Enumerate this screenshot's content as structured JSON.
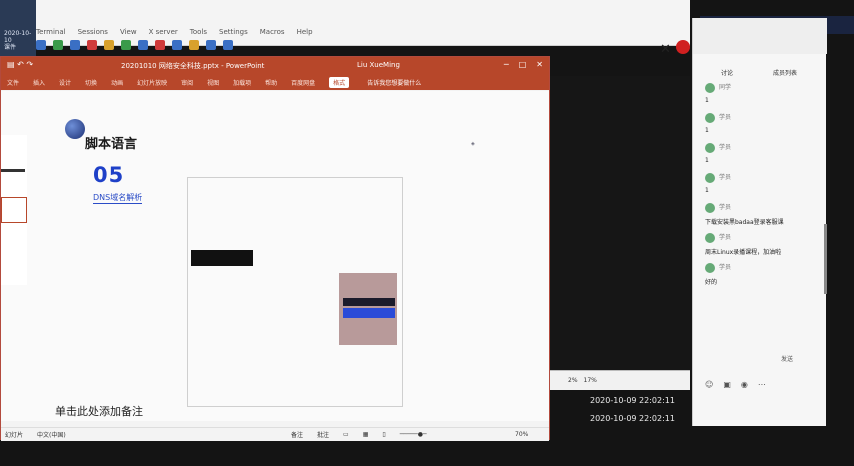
{
  "top_app": {
    "menu": [
      "Terminal",
      "Sessions",
      "View",
      "X server",
      "Tools",
      "Settings",
      "Macros",
      "Help"
    ],
    "left_icons": [
      "2020-10-10",
      "课件"
    ]
  },
  "powerpoint": {
    "title": "20201010 网络安全科技.pptx - PowerPoint",
    "user": "Liu XueMing",
    "ribbon_tabs": [
      "文件",
      "插入",
      "设计",
      "切换",
      "动画",
      "幻灯片放映",
      "审阅",
      "视图",
      "加载项",
      "帮助",
      "百度网盘",
      "格式"
    ],
    "active_tab": "格式",
    "tell_me": "告诉我您想要做什么",
    "slide": {
      "heading": "脚本语言",
      "number": "05",
      "subtitle": "DNS域名解析",
      "notes": "单击此处添加备注"
    },
    "status": {
      "left": [
        "幻灯片",
        "中文(中国)"
      ],
      "right": [
        "备注",
        "批注"
      ],
      "zoom": "70%"
    }
  },
  "timestamps": [
    "2020-10-09 22:02:11",
    "2020-10-09 22:02:11"
  ],
  "chat": {
    "tabs": [
      "讨论",
      "成员列表"
    ],
    "messages": [
      {
        "name": "同学",
        "text": "1"
      },
      {
        "name": "学员",
        "text": "1"
      },
      {
        "name": "学员",
        "text": "1"
      },
      {
        "name": "学员",
        "text": "1"
      },
      {
        "name": "学员",
        "text": "下载安装黑badaa登录客服课"
      },
      {
        "name": "学员",
        "text": "周末Linux录播课程，加油啦"
      },
      {
        "name": "学员",
        "text": "好的"
      }
    ],
    "send_label": "发送"
  }
}
